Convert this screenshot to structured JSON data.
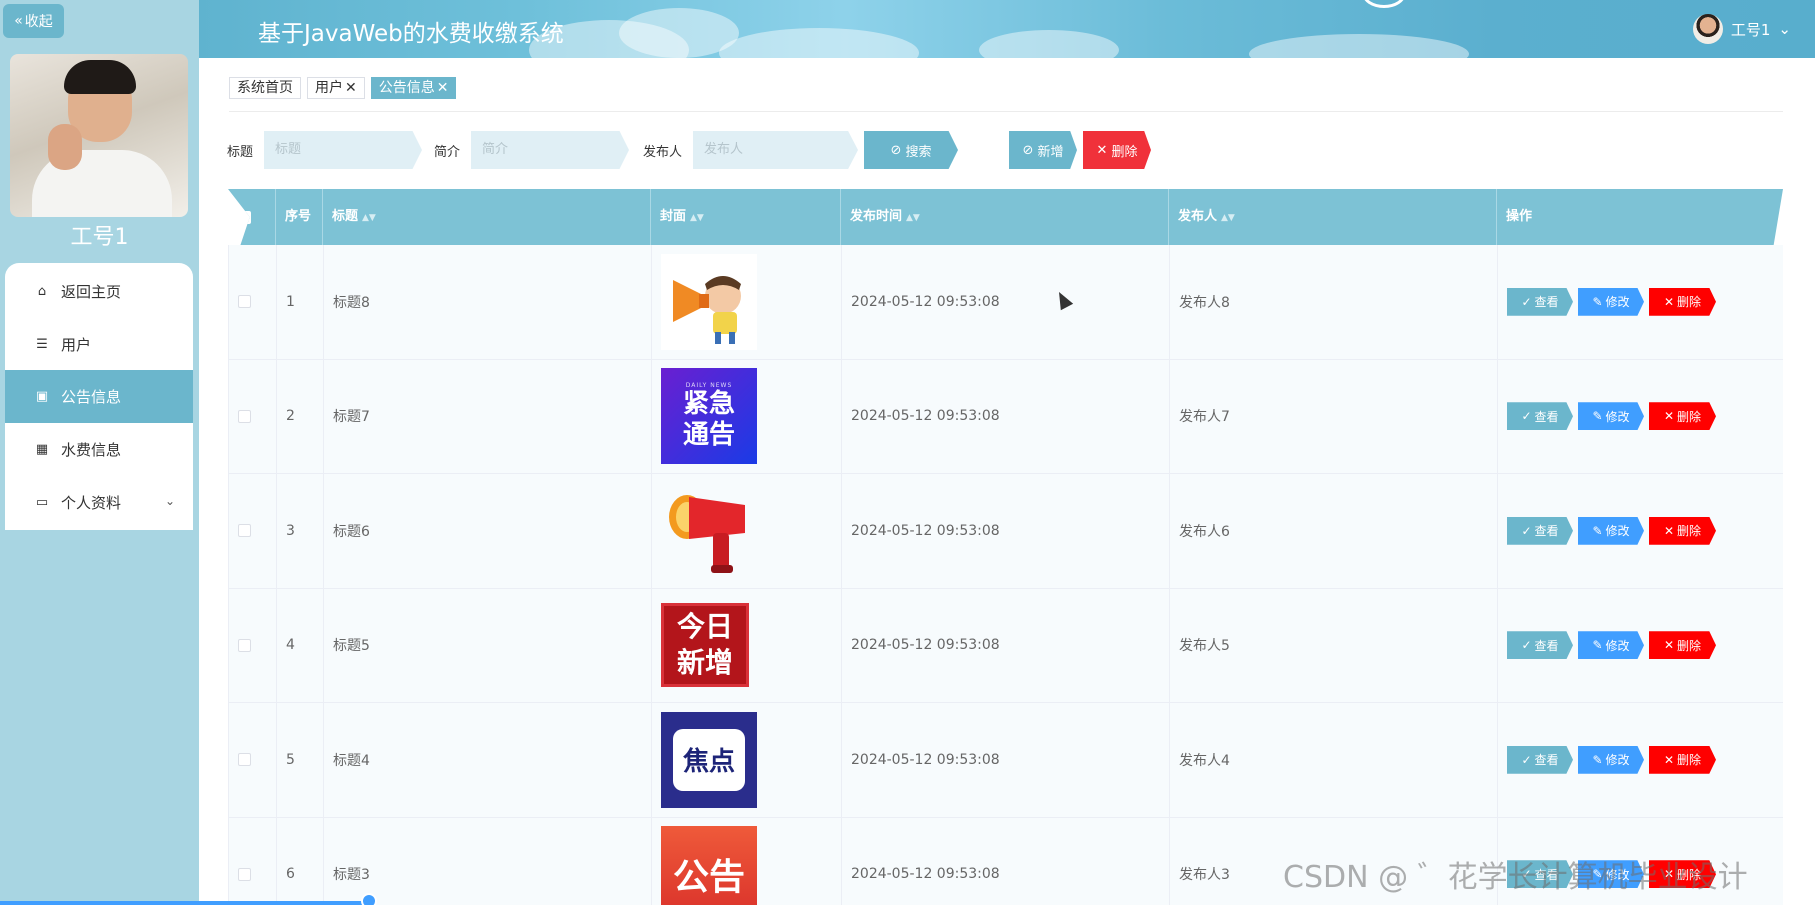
{
  "sidebar": {
    "collapse_label": "收起",
    "user_name": "工号1",
    "menu": [
      {
        "label": "返回主页",
        "icon": "home-icon",
        "glyph": "⌂"
      },
      {
        "label": "用户",
        "icon": "list-icon",
        "glyph": "☰"
      },
      {
        "label": "公告信息",
        "icon": "clipboard-icon",
        "glyph": "▣"
      },
      {
        "label": "水费信息",
        "icon": "grid-icon",
        "glyph": "▦"
      },
      {
        "label": "个人资料",
        "icon": "card-icon",
        "glyph": "▭"
      }
    ]
  },
  "header": {
    "title": "基于JavaWeb的水费收缴系统",
    "user_label": "工号1"
  },
  "tags": [
    {
      "label": "系统首页"
    },
    {
      "label": "用户"
    },
    {
      "label": "公告信息"
    }
  ],
  "search": {
    "title_label": "标题",
    "title_placeholder": "标题",
    "intro_label": "简介",
    "intro_placeholder": "简介",
    "publisher_label": "发布人",
    "publisher_placeholder": "发布人",
    "search_button": "搜索",
    "add_button": "新增",
    "delete_button": "删除"
  },
  "table": {
    "columns": [
      "序号",
      "标题",
      "封面",
      "发布时间",
      "发布人",
      "操作"
    ],
    "actions": {
      "view": "查看",
      "edit": "修改",
      "delete": "删除"
    },
    "rows": [
      {
        "index": "1",
        "title": "标题8",
        "time": "2024-05-12 09:53:08",
        "publisher": "发布人8",
        "cover": "megaphone-kid"
      },
      {
        "index": "2",
        "title": "标题7",
        "time": "2024-05-12 09:53:08",
        "publisher": "发布人7",
        "cover": "urgent-notice",
        "cover_text": "紧急通告",
        "cover_small": "DAILY NEWS"
      },
      {
        "index": "3",
        "title": "标题6",
        "time": "2024-05-12 09:53:08",
        "publisher": "发布人6",
        "cover": "red-megaphone"
      },
      {
        "index": "4",
        "title": "标题5",
        "time": "2024-05-12 09:53:08",
        "publisher": "发布人5",
        "cover": "today-new",
        "cover_text": "今日新增"
      },
      {
        "index": "5",
        "title": "标题4",
        "time": "2024-05-12 09:53:08",
        "publisher": "发布人4",
        "cover": "focus",
        "cover_text": "焦点"
      },
      {
        "index": "6",
        "title": "标题3",
        "time": "2024-05-12 09:53:08",
        "publisher": "发布人3",
        "cover": "announcement",
        "cover_text": "公告"
      }
    ]
  },
  "watermark": "CSDN @ ゛花学长计算机毕业设计",
  "colors": {
    "accent": "#6bb6cc",
    "edit": "#409eff",
    "danger": "#ff0000"
  }
}
